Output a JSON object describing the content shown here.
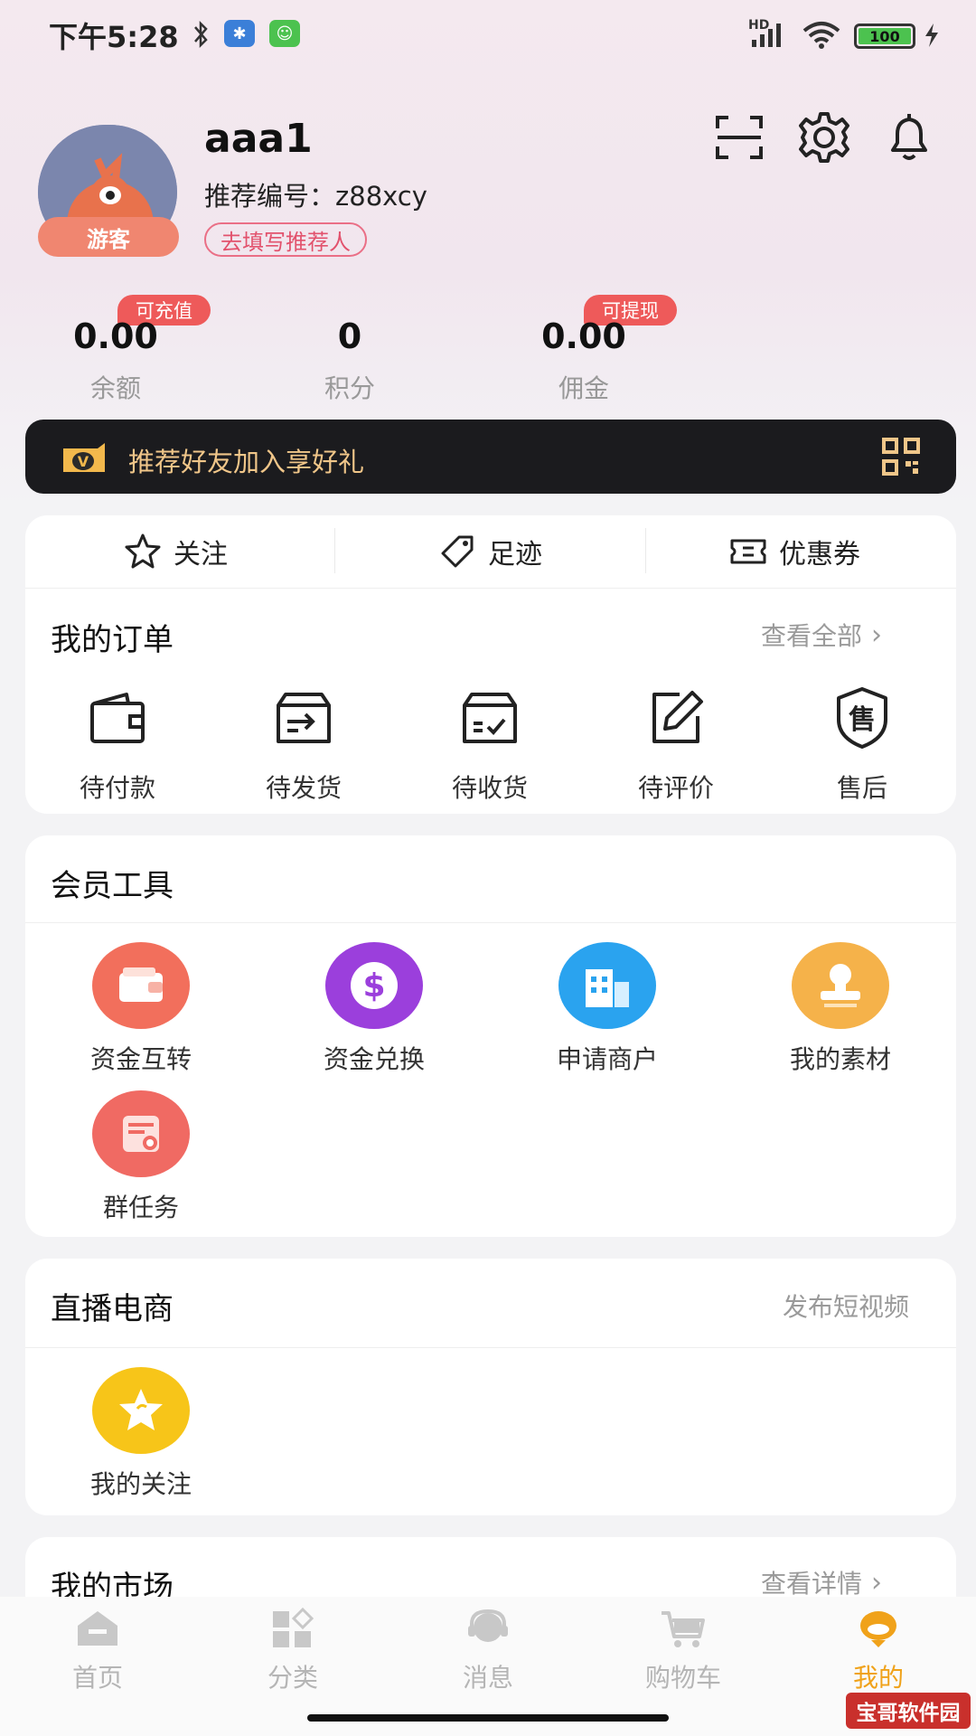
{
  "status_bar": {
    "time": "下午5:28",
    "network": "HD",
    "battery": "100"
  },
  "profile": {
    "username": "aaa1",
    "ref_code_label": "推荐编号：",
    "ref_code": "z88xcy",
    "guest_badge": "游客",
    "ref_link": "去填写推荐人"
  },
  "stats": [
    {
      "value": "0.00",
      "label": "余额",
      "tag": "可充值"
    },
    {
      "value": "0",
      "label": "积分",
      "tag": ""
    },
    {
      "value": "0.00",
      "label": "佣金",
      "tag": "可提现"
    }
  ],
  "invite": {
    "text": "推荐好友加入享好礼"
  },
  "quick_links": [
    {
      "label": "关注",
      "icon": "star-icon"
    },
    {
      "label": "足迹",
      "icon": "tag-icon"
    },
    {
      "label": "优惠券",
      "icon": "coupon-icon"
    }
  ],
  "orders": {
    "title": "我的订单",
    "view_all": "查看全部",
    "items": [
      {
        "label": "待付款",
        "icon": "wallet-icon"
      },
      {
        "label": "待发货",
        "icon": "ship-box-icon"
      },
      {
        "label": "待收货",
        "icon": "receive-box-icon"
      },
      {
        "label": "待评价",
        "icon": "edit-review-icon"
      },
      {
        "label": "售后",
        "icon": "after-sale-shield-icon"
      }
    ]
  },
  "member_tools": {
    "title": "会员工具",
    "items": [
      {
        "label": "资金互转",
        "icon": "wallet-transfer-icon",
        "color": "#f26f5c"
      },
      {
        "label": "资金兑换",
        "icon": "dollar-icon",
        "color": "#9b3fdc"
      },
      {
        "label": "申请商户",
        "icon": "building-icon",
        "color": "#2aa3ef"
      },
      {
        "label": "我的素材",
        "icon": "stamp-icon",
        "color": "#f5b24a"
      },
      {
        "label": "群任务",
        "icon": "task-card-icon",
        "color": "#f06a63"
      }
    ]
  },
  "live": {
    "title": "直播电商",
    "action": "发布短视频",
    "items": [
      {
        "label": "我的关注",
        "icon": "star-circle-icon",
        "color": "#f7c519"
      }
    ]
  },
  "market": {
    "title": "我的市场",
    "action": "查看详情"
  },
  "bottom_nav": [
    {
      "label": "首页",
      "icon": "home-icon",
      "active": false
    },
    {
      "label": "分类",
      "icon": "category-icon",
      "active": false
    },
    {
      "label": "消息",
      "icon": "message-icon",
      "active": false
    },
    {
      "label": "购物车",
      "icon": "cart-icon",
      "active": false
    },
    {
      "label": "我的",
      "icon": "mine-icon",
      "active": true
    }
  ],
  "watermark": "宝哥软件园",
  "colors": {
    "accent": "#f0a21a",
    "banner_text": "#f0c689",
    "badge": "#ee5a5a"
  }
}
